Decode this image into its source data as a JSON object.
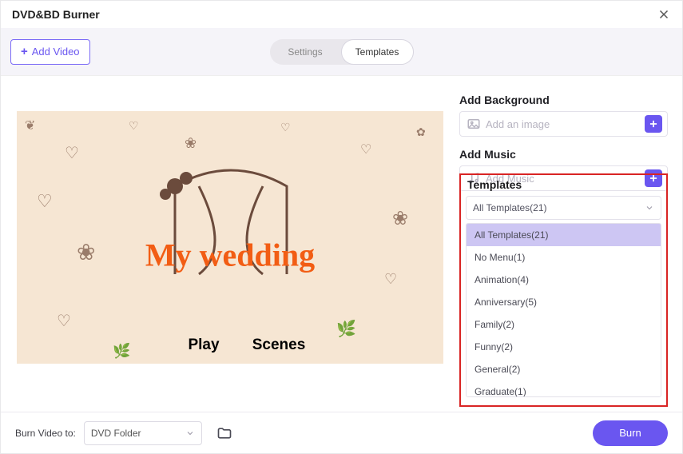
{
  "window": {
    "title": "DVD&BD Burner"
  },
  "toolbar": {
    "add_video_label": "Add Video",
    "seg_settings": "Settings",
    "seg_templates": "Templates"
  },
  "preview": {
    "title": "My wedding",
    "play_label": "Play",
    "scenes_label": "Scenes"
  },
  "side": {
    "bg_head": "Add Background",
    "bg_placeholder": "Add an image",
    "music_head": "Add Music",
    "music_placeholder": "Add Music",
    "templates_head": "Templates",
    "templates_selected": "All Templates(21)",
    "templates_options": [
      "All Templates(21)",
      "No Menu(1)",
      "Animation(4)",
      "Anniversary(5)",
      "Family(2)",
      "Funny(2)",
      "General(2)",
      "Graduate(1)"
    ]
  },
  "bottom": {
    "burn_video_to_label": "Burn Video to:",
    "burn_video_to_value": "DVD Folder",
    "burn_label": "Burn"
  }
}
